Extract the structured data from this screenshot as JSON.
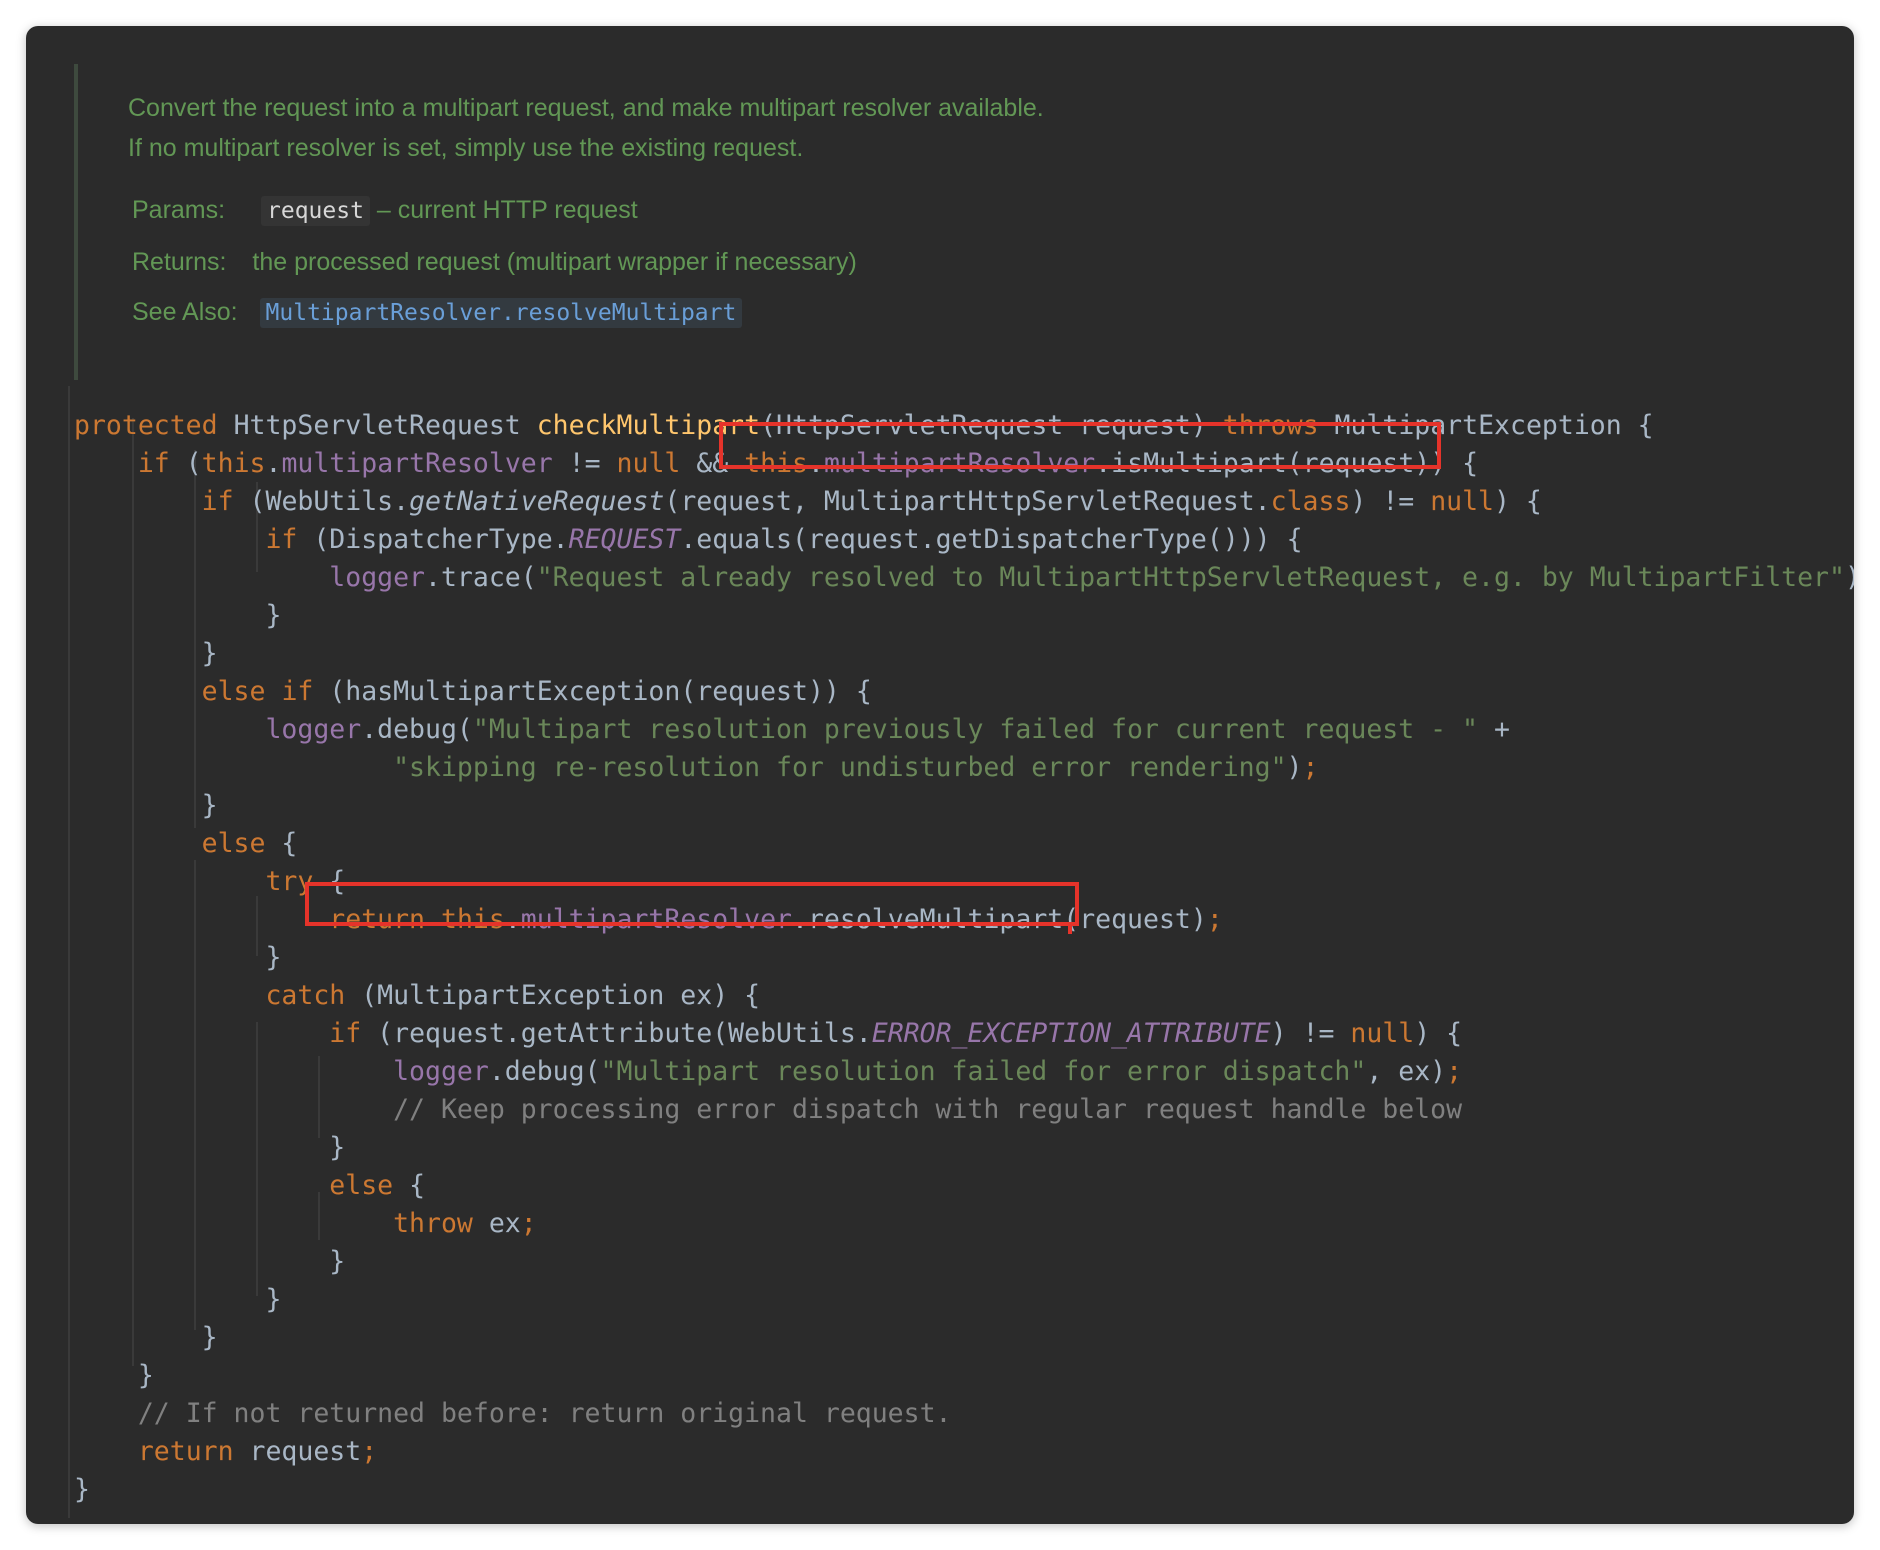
{
  "javadoc": {
    "summary_1": "Convert the request into a multipart request, and make multipart resolver available.",
    "summary_2": "If no multipart resolver is set, simply use the existing request.",
    "params_label": "Params:",
    "param_name": "request",
    "param_desc": "– current HTTP request",
    "returns_label": "Returns:",
    "returns_desc": "the processed request (multipart wrapper if necessary)",
    "see_also_label": "See Also:",
    "see_also_link": "MultipartResolver.resolveMultipart"
  },
  "code": {
    "kw_protected": "protected",
    "kw_if": "if",
    "kw_else": "else",
    "kw_try": "try",
    "kw_catch": "catch",
    "kw_return": "return",
    "kw_throw": "throw",
    "kw_throws": "throws",
    "kw_null": "null",
    "kw_this": "this",
    "kw_class": "class",
    "type_request": "HttpServletRequest",
    "method_name": "checkMultipart",
    "param_decl": "(HttpServletRequest request)",
    "exception_type": "MultipartException",
    "field_resolver": "multipartResolver",
    "is_multipart_call": ".isMultipart(request))",
    "webutils_prefix": "(WebUtils.",
    "get_native_request": "getNativeRequest",
    "native_args": "(request, MultipartHttpServletRequest.",
    "dispatcher_prefix": "(DispatcherType.",
    "const_request": "REQUEST",
    "equals_call": ".equals(request.getDispatcherType())) {",
    "logger": "logger",
    "trace_call": ".trace(",
    "trace_msg": "\"Request already resolved to MultipartHttpServletRequest, e.g. by MultipartFilter\"",
    "has_exception_call": "(hasMultipartException(request)) {",
    "debug_call": ".debug(",
    "debug_msg_1": "\"Multipart resolution previously failed for current request - \"",
    "debug_msg_2": "\"skipping re-resolution for undisturbed error rendering\"",
    "resolve_call": ".resolveMultipart(request)",
    "catch_decl": "(MultipartException ex) {",
    "get_attribute_prefix": "(request.getAttribute(WebUtils.",
    "const_error_attr": "ERROR_EXCEPTION_ATTRIBUTE",
    "debug_msg_3": "\"Multipart resolution failed for error dispatch\"",
    "ex_arg": ", ex)",
    "comment_keep": "// Keep processing error dispatch with regular request handle below",
    "throw_target": " ex",
    "comment_return": "// If not returned before: return original request.",
    "return_target": " request"
  },
  "colors": {
    "background": "#2b2b2b",
    "keyword": "#cc7832",
    "method": "#ffc66d",
    "field": "#9876aa",
    "string": "#6a8759",
    "comment": "#808080",
    "javadoc": "#629755",
    "highlight_box": "#e5332a"
  }
}
